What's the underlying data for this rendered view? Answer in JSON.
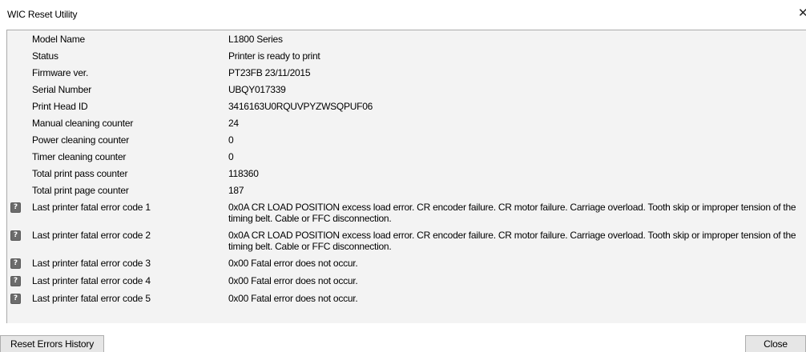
{
  "window": {
    "title": "WIC Reset Utility",
    "close_glyph": "✕"
  },
  "icons": {
    "help": "?"
  },
  "rows": [
    {
      "label": "Model Name",
      "value": "L1800 Series",
      "icon": false
    },
    {
      "label": "Status",
      "value": "Printer is ready to print",
      "icon": false
    },
    {
      "label": "Firmware ver.",
      "value": "PT23FB 23/11/2015",
      "icon": false
    },
    {
      "label": "Serial Number",
      "value": "UBQY017339",
      "icon": false
    },
    {
      "label": "Print Head ID",
      "value": "3416163U0RQUVPYZWSQPUF06",
      "icon": false
    },
    {
      "label": "Manual cleaning counter",
      "value": "24",
      "icon": false
    },
    {
      "label": "Power cleaning counter",
      "value": "0",
      "icon": false
    },
    {
      "label": "Timer cleaning counter",
      "value": "0",
      "icon": false
    },
    {
      "label": "Total print pass counter",
      "value": "118360",
      "icon": false
    },
    {
      "label": "Total print page counter",
      "value": "187",
      "icon": false
    },
    {
      "label": "Last printer fatal error code 1",
      "value": "0x0A CR LOAD POSITION excess load error. CR encoder failure. CR motor failure. Carriage overload. Tooth skip or improper tension of the timing belt. Cable or FFC disconnection.",
      "icon": true
    },
    {
      "label": "Last printer fatal error code 2",
      "value": "0x0A CR LOAD POSITION excess load error. CR encoder failure. CR motor failure. Carriage overload. Tooth skip or improper tension of the timing belt. Cable or FFC disconnection.",
      "icon": true
    },
    {
      "label": "Last printer fatal error code 3",
      "value": "0x00 Fatal error does not occur.",
      "icon": true
    },
    {
      "label": "Last printer fatal error code 4",
      "value": "0x00 Fatal error does not occur.",
      "icon": true
    },
    {
      "label": "Last printer fatal error code 5",
      "value": "0x00 Fatal error does not occur.",
      "icon": true
    }
  ],
  "buttons": {
    "reset_errors_history": "Reset Errors History",
    "close": "Close"
  }
}
